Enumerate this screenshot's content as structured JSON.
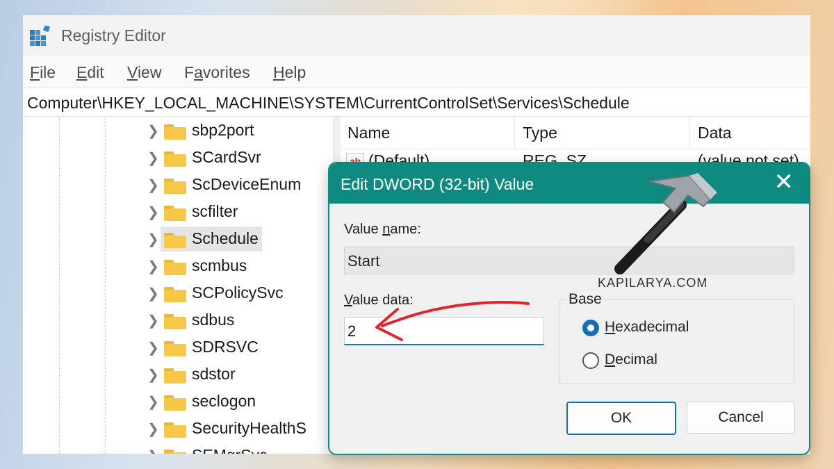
{
  "window": {
    "title": "Registry Editor"
  },
  "menu": [
    {
      "label_pre": "",
      "label_key": "F",
      "label_post": "ile"
    },
    {
      "label_pre": "",
      "label_key": "E",
      "label_post": "dit"
    },
    {
      "label_pre": "",
      "label_key": "V",
      "label_post": "iew"
    },
    {
      "label_pre": "F",
      "label_key": "a",
      "label_post": "vorites"
    },
    {
      "label_pre": "",
      "label_key": "H",
      "label_post": "elp"
    }
  ],
  "address": "Computer\\HKEY_LOCAL_MACHINE\\SYSTEM\\CurrentControlSet\\Services\\Schedule",
  "tree": {
    "items": [
      {
        "label": "sbp2port"
      },
      {
        "label": "SCardSvr"
      },
      {
        "label": "ScDeviceEnum"
      },
      {
        "label": "scfilter"
      },
      {
        "label": "Schedule"
      },
      {
        "label": "scmbus"
      },
      {
        "label": "SCPolicySvc"
      },
      {
        "label": "sdbus"
      },
      {
        "label": "SDRSVC"
      },
      {
        "label": "sdstor"
      },
      {
        "label": "seclogon"
      },
      {
        "label": "SecurityHealthS"
      },
      {
        "label": "SEMgrSvc"
      }
    ],
    "selected_index": 4
  },
  "list": {
    "columns": [
      "Name",
      "Type",
      "Data"
    ],
    "rows": [
      {
        "name": "(Default)",
        "type": "REG_SZ",
        "data": "(value not set)"
      }
    ]
  },
  "dialog": {
    "title": "Edit DWORD (32-bit) Value",
    "close_glyph": "✕",
    "value_name_label_pre": "Value ",
    "value_name_label_key": "n",
    "value_name_label_post": "ame:",
    "value_name": "Start",
    "value_data_label_pre": "",
    "value_data_label_key": "V",
    "value_data_label_post": "alue data:",
    "value_data": "2",
    "base_label": "Base",
    "hex_label_key": "H",
    "hex_label_post": "exadecimal",
    "dec_label_key": "D",
    "dec_label_post": "ecimal",
    "hex_selected": true,
    "ok_label": "OK",
    "cancel_label": "Cancel"
  },
  "watermark": "KAPILARYA.COM",
  "colors": {
    "accent": "#0e8a80",
    "radio": "#0e6fb3",
    "arrow": "#e0242b"
  }
}
